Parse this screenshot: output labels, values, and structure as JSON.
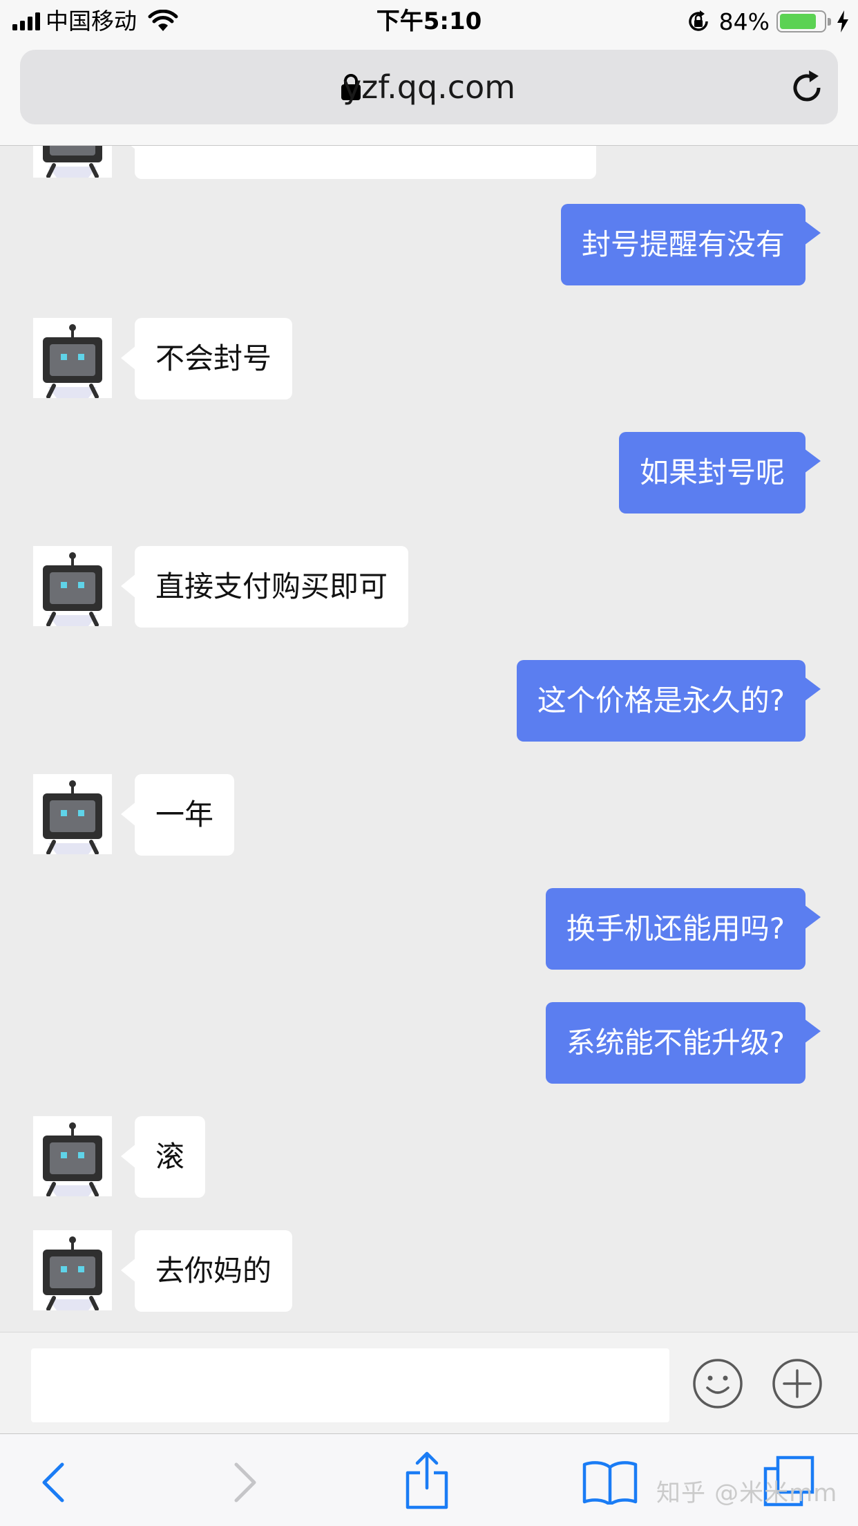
{
  "status_bar": {
    "carrier": "中国移动",
    "time": "下午5:10",
    "battery_percent": "84%",
    "battery_level": 0.84,
    "icons": [
      "signal-icon",
      "wifi-icon",
      "rotation-lock-icon",
      "battery-icon",
      "charging-bolt-icon"
    ]
  },
  "browser": {
    "url": "yzf.qq.com",
    "icons": [
      "lock-icon",
      "reload-icon"
    ]
  },
  "chat": {
    "messages": [
      {
        "from": "bot",
        "text": ""
      },
      {
        "from": "user",
        "text": "封号提醒有没有"
      },
      {
        "from": "bot",
        "text": "不会封号"
      },
      {
        "from": "user",
        "text": "如果封号呢"
      },
      {
        "from": "bot",
        "text": "直接支付购买即可"
      },
      {
        "from": "user",
        "text": "这个价格是永久的?"
      },
      {
        "from": "bot",
        "text": "一年"
      },
      {
        "from": "user",
        "text": "换手机还能用吗?"
      },
      {
        "from": "user",
        "text": "系统能不能升级?"
      },
      {
        "from": "bot",
        "text": "滚"
      },
      {
        "from": "bot",
        "text": "去你妈的"
      }
    ]
  },
  "input_bar": {
    "value": "",
    "placeholder": "",
    "icons": [
      "emoji-icon",
      "plus-icon"
    ]
  },
  "toolbar": {
    "icons": [
      "back-icon",
      "forward-icon",
      "share-icon",
      "bookmarks-icon",
      "tabs-icon"
    ]
  },
  "watermark": "知乎 @米米mm",
  "colors": {
    "user_bubble": "#5b7ef0",
    "bot_bubble": "#ffffff",
    "chat_background": "#ececec",
    "browser_blue": "#1a7cf5",
    "battery_green": "#5bd253"
  }
}
